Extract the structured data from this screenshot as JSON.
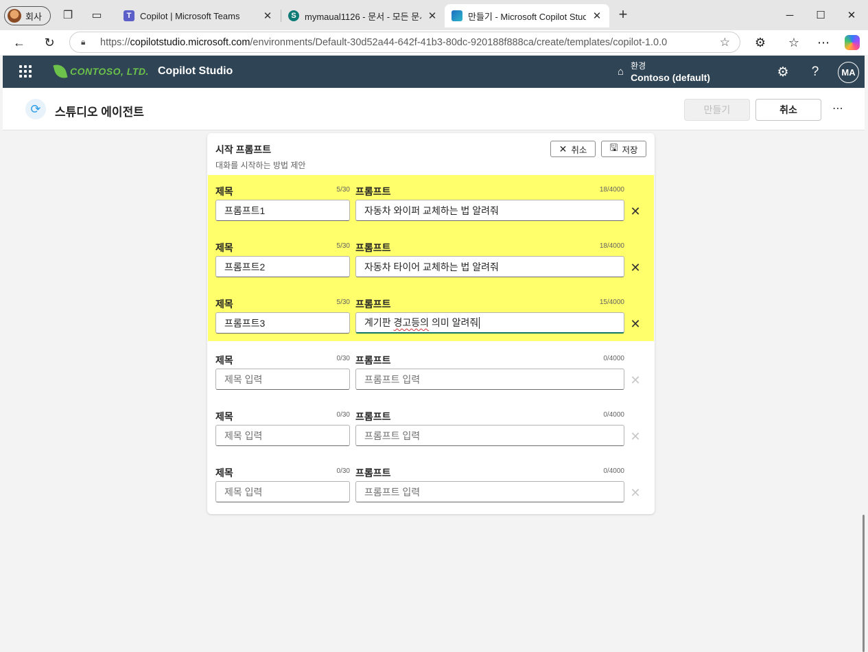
{
  "browser": {
    "profile_label": "회사",
    "tabs": [
      {
        "title": "Copilot | Microsoft Teams",
        "favicon": "teams-icon"
      },
      {
        "title": "mymaual1126 - 문서 - 모든 문서",
        "favicon": "sharepoint-icon"
      },
      {
        "title": "만들기 - Microsoft Copilot Studio",
        "favicon": "copilot-studio-icon",
        "active": true
      }
    ],
    "url_prefix": "https://",
    "url_host": "copilotstudio.microsoft.com",
    "url_path": "/environments/Default-30d52a44-642f-41b3-80dc-920188f888ca/create/templates/copilot-1.0.0"
  },
  "appbar": {
    "brand": "CONTOSO, LTD.",
    "product": "Copilot Studio",
    "env_label": "환경",
    "env_name": "Contoso (default)",
    "user_initials": "MA"
  },
  "pageheader": {
    "title": "스튜디오 에이전트",
    "create_label": "만들기",
    "cancel_label": "취소"
  },
  "panel": {
    "title": "시작 프롬프트",
    "subtitle": "대화를 시작하는 방법 제안",
    "cancel_label": "취소",
    "save_label": "저장",
    "rows": [
      {
        "title_label": "제목",
        "title_count": "5/30",
        "prompt_label": "프롬프트",
        "prompt_count": "18/4000",
        "title_value": "프롬프트1",
        "prompt_value": "자동차 와이퍼 교체하는 법 알려줘"
      },
      {
        "title_label": "제목",
        "title_count": "5/30",
        "prompt_label": "프롬프트",
        "prompt_count": "18/4000",
        "title_value": "프롬프트2",
        "prompt_value": "자동차 타이어 교체하는 법 알려줘"
      },
      {
        "title_label": "제목",
        "title_count": "5/30",
        "prompt_label": "프롬프트",
        "prompt_count": "15/4000",
        "title_value": "프롬프트3",
        "prompt_value_pre": "계기판 ",
        "prompt_value_err": "경고등의",
        "prompt_value_post": " 의미 알려줘"
      },
      {
        "title_label": "제목",
        "title_count": "0/30",
        "prompt_label": "프롬프트",
        "prompt_count": "0/4000",
        "title_placeholder": "제목 입력",
        "prompt_placeholder": "프롬프트 입력"
      },
      {
        "title_label": "제목",
        "title_count": "0/30",
        "prompt_label": "프롬프트",
        "prompt_count": "0/4000",
        "title_placeholder": "제목 입력",
        "prompt_placeholder": "프롬프트 입력"
      },
      {
        "title_label": "제목",
        "title_count": "0/30",
        "prompt_label": "프롬프트",
        "prompt_count": "0/4000",
        "title_placeholder": "제목 입력",
        "prompt_placeholder": "프롬프트 입력"
      }
    ]
  },
  "colors": {
    "appbar_bg": "#2f4454",
    "brand_green": "#6cc24a",
    "highlight": "#ffff6b",
    "focus_underline": "#117865"
  }
}
